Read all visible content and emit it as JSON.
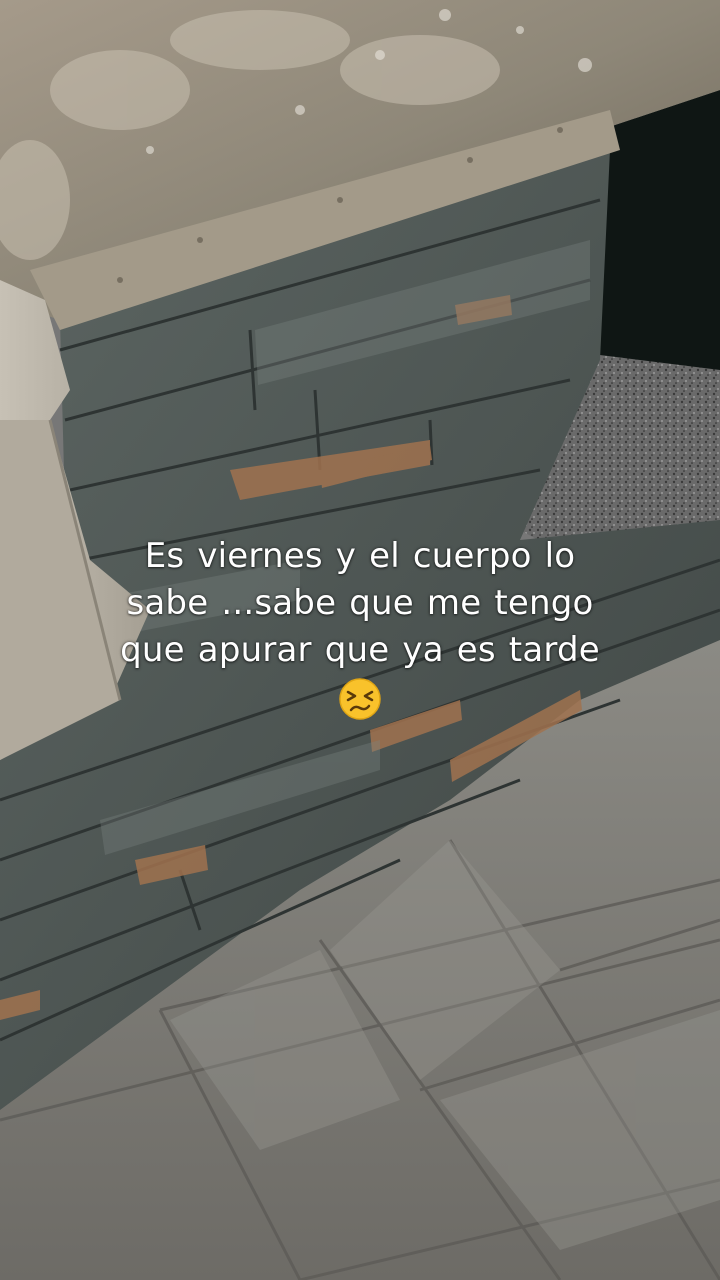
{
  "caption": {
    "line1": "Es viernes  y el cuerpo lo",
    "line2": "sabe  ...sabe  que  me tengo",
    "line3": "que  apurar  que  ya es  tarde",
    "emoji": "persevering-face-emoji"
  }
}
